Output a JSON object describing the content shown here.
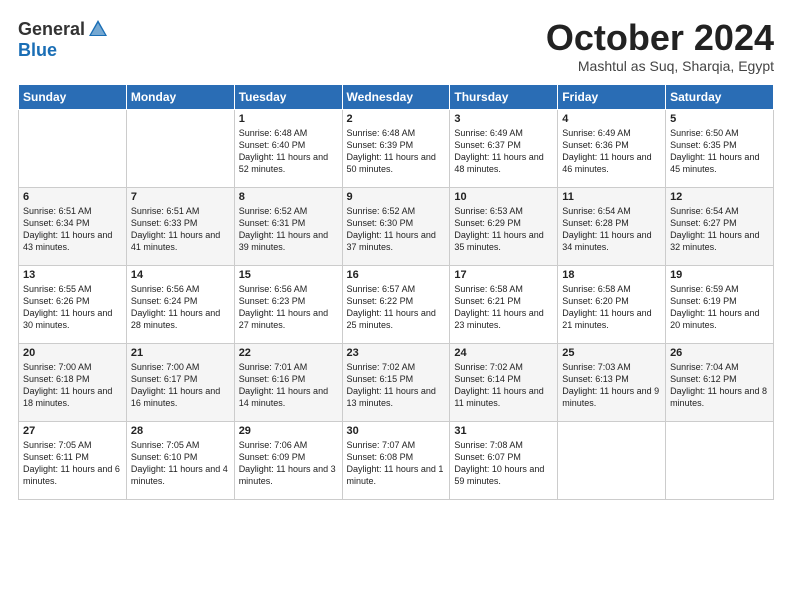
{
  "header": {
    "logo_general": "General",
    "logo_blue": "Blue",
    "month_title": "October 2024",
    "subtitle": "Mashtul as Suq, Sharqia, Egypt"
  },
  "days_of_week": [
    "Sunday",
    "Monday",
    "Tuesday",
    "Wednesday",
    "Thursday",
    "Friday",
    "Saturday"
  ],
  "weeks": [
    [
      {
        "day": "",
        "content": ""
      },
      {
        "day": "",
        "content": ""
      },
      {
        "day": "1",
        "sunrise": "Sunrise: 6:48 AM",
        "sunset": "Sunset: 6:40 PM",
        "daylight": "Daylight: 11 hours and 52 minutes."
      },
      {
        "day": "2",
        "sunrise": "Sunrise: 6:48 AM",
        "sunset": "Sunset: 6:39 PM",
        "daylight": "Daylight: 11 hours and 50 minutes."
      },
      {
        "day": "3",
        "sunrise": "Sunrise: 6:49 AM",
        "sunset": "Sunset: 6:37 PM",
        "daylight": "Daylight: 11 hours and 48 minutes."
      },
      {
        "day": "4",
        "sunrise": "Sunrise: 6:49 AM",
        "sunset": "Sunset: 6:36 PM",
        "daylight": "Daylight: 11 hours and 46 minutes."
      },
      {
        "day": "5",
        "sunrise": "Sunrise: 6:50 AM",
        "sunset": "Sunset: 6:35 PM",
        "daylight": "Daylight: 11 hours and 45 minutes."
      }
    ],
    [
      {
        "day": "6",
        "sunrise": "Sunrise: 6:51 AM",
        "sunset": "Sunset: 6:34 PM",
        "daylight": "Daylight: 11 hours and 43 minutes."
      },
      {
        "day": "7",
        "sunrise": "Sunrise: 6:51 AM",
        "sunset": "Sunset: 6:33 PM",
        "daylight": "Daylight: 11 hours and 41 minutes."
      },
      {
        "day": "8",
        "sunrise": "Sunrise: 6:52 AM",
        "sunset": "Sunset: 6:31 PM",
        "daylight": "Daylight: 11 hours and 39 minutes."
      },
      {
        "day": "9",
        "sunrise": "Sunrise: 6:52 AM",
        "sunset": "Sunset: 6:30 PM",
        "daylight": "Daylight: 11 hours and 37 minutes."
      },
      {
        "day": "10",
        "sunrise": "Sunrise: 6:53 AM",
        "sunset": "Sunset: 6:29 PM",
        "daylight": "Daylight: 11 hours and 35 minutes."
      },
      {
        "day": "11",
        "sunrise": "Sunrise: 6:54 AM",
        "sunset": "Sunset: 6:28 PM",
        "daylight": "Daylight: 11 hours and 34 minutes."
      },
      {
        "day": "12",
        "sunrise": "Sunrise: 6:54 AM",
        "sunset": "Sunset: 6:27 PM",
        "daylight": "Daylight: 11 hours and 32 minutes."
      }
    ],
    [
      {
        "day": "13",
        "sunrise": "Sunrise: 6:55 AM",
        "sunset": "Sunset: 6:26 PM",
        "daylight": "Daylight: 11 hours and 30 minutes."
      },
      {
        "day": "14",
        "sunrise": "Sunrise: 6:56 AM",
        "sunset": "Sunset: 6:24 PM",
        "daylight": "Daylight: 11 hours and 28 minutes."
      },
      {
        "day": "15",
        "sunrise": "Sunrise: 6:56 AM",
        "sunset": "Sunset: 6:23 PM",
        "daylight": "Daylight: 11 hours and 27 minutes."
      },
      {
        "day": "16",
        "sunrise": "Sunrise: 6:57 AM",
        "sunset": "Sunset: 6:22 PM",
        "daylight": "Daylight: 11 hours and 25 minutes."
      },
      {
        "day": "17",
        "sunrise": "Sunrise: 6:58 AM",
        "sunset": "Sunset: 6:21 PM",
        "daylight": "Daylight: 11 hours and 23 minutes."
      },
      {
        "day": "18",
        "sunrise": "Sunrise: 6:58 AM",
        "sunset": "Sunset: 6:20 PM",
        "daylight": "Daylight: 11 hours and 21 minutes."
      },
      {
        "day": "19",
        "sunrise": "Sunrise: 6:59 AM",
        "sunset": "Sunset: 6:19 PM",
        "daylight": "Daylight: 11 hours and 20 minutes."
      }
    ],
    [
      {
        "day": "20",
        "sunrise": "Sunrise: 7:00 AM",
        "sunset": "Sunset: 6:18 PM",
        "daylight": "Daylight: 11 hours and 18 minutes."
      },
      {
        "day": "21",
        "sunrise": "Sunrise: 7:00 AM",
        "sunset": "Sunset: 6:17 PM",
        "daylight": "Daylight: 11 hours and 16 minutes."
      },
      {
        "day": "22",
        "sunrise": "Sunrise: 7:01 AM",
        "sunset": "Sunset: 6:16 PM",
        "daylight": "Daylight: 11 hours and 14 minutes."
      },
      {
        "day": "23",
        "sunrise": "Sunrise: 7:02 AM",
        "sunset": "Sunset: 6:15 PM",
        "daylight": "Daylight: 11 hours and 13 minutes."
      },
      {
        "day": "24",
        "sunrise": "Sunrise: 7:02 AM",
        "sunset": "Sunset: 6:14 PM",
        "daylight": "Daylight: 11 hours and 11 minutes."
      },
      {
        "day": "25",
        "sunrise": "Sunrise: 7:03 AM",
        "sunset": "Sunset: 6:13 PM",
        "daylight": "Daylight: 11 hours and 9 minutes."
      },
      {
        "day": "26",
        "sunrise": "Sunrise: 7:04 AM",
        "sunset": "Sunset: 6:12 PM",
        "daylight": "Daylight: 11 hours and 8 minutes."
      }
    ],
    [
      {
        "day": "27",
        "sunrise": "Sunrise: 7:05 AM",
        "sunset": "Sunset: 6:11 PM",
        "daylight": "Daylight: 11 hours and 6 minutes."
      },
      {
        "day": "28",
        "sunrise": "Sunrise: 7:05 AM",
        "sunset": "Sunset: 6:10 PM",
        "daylight": "Daylight: 11 hours and 4 minutes."
      },
      {
        "day": "29",
        "sunrise": "Sunrise: 7:06 AM",
        "sunset": "Sunset: 6:09 PM",
        "daylight": "Daylight: 11 hours and 3 minutes."
      },
      {
        "day": "30",
        "sunrise": "Sunrise: 7:07 AM",
        "sunset": "Sunset: 6:08 PM",
        "daylight": "Daylight: 11 hours and 1 minute."
      },
      {
        "day": "31",
        "sunrise": "Sunrise: 7:08 AM",
        "sunset": "Sunset: 6:07 PM",
        "daylight": "Daylight: 10 hours and 59 minutes."
      },
      {
        "day": "",
        "content": ""
      },
      {
        "day": "",
        "content": ""
      }
    ]
  ]
}
